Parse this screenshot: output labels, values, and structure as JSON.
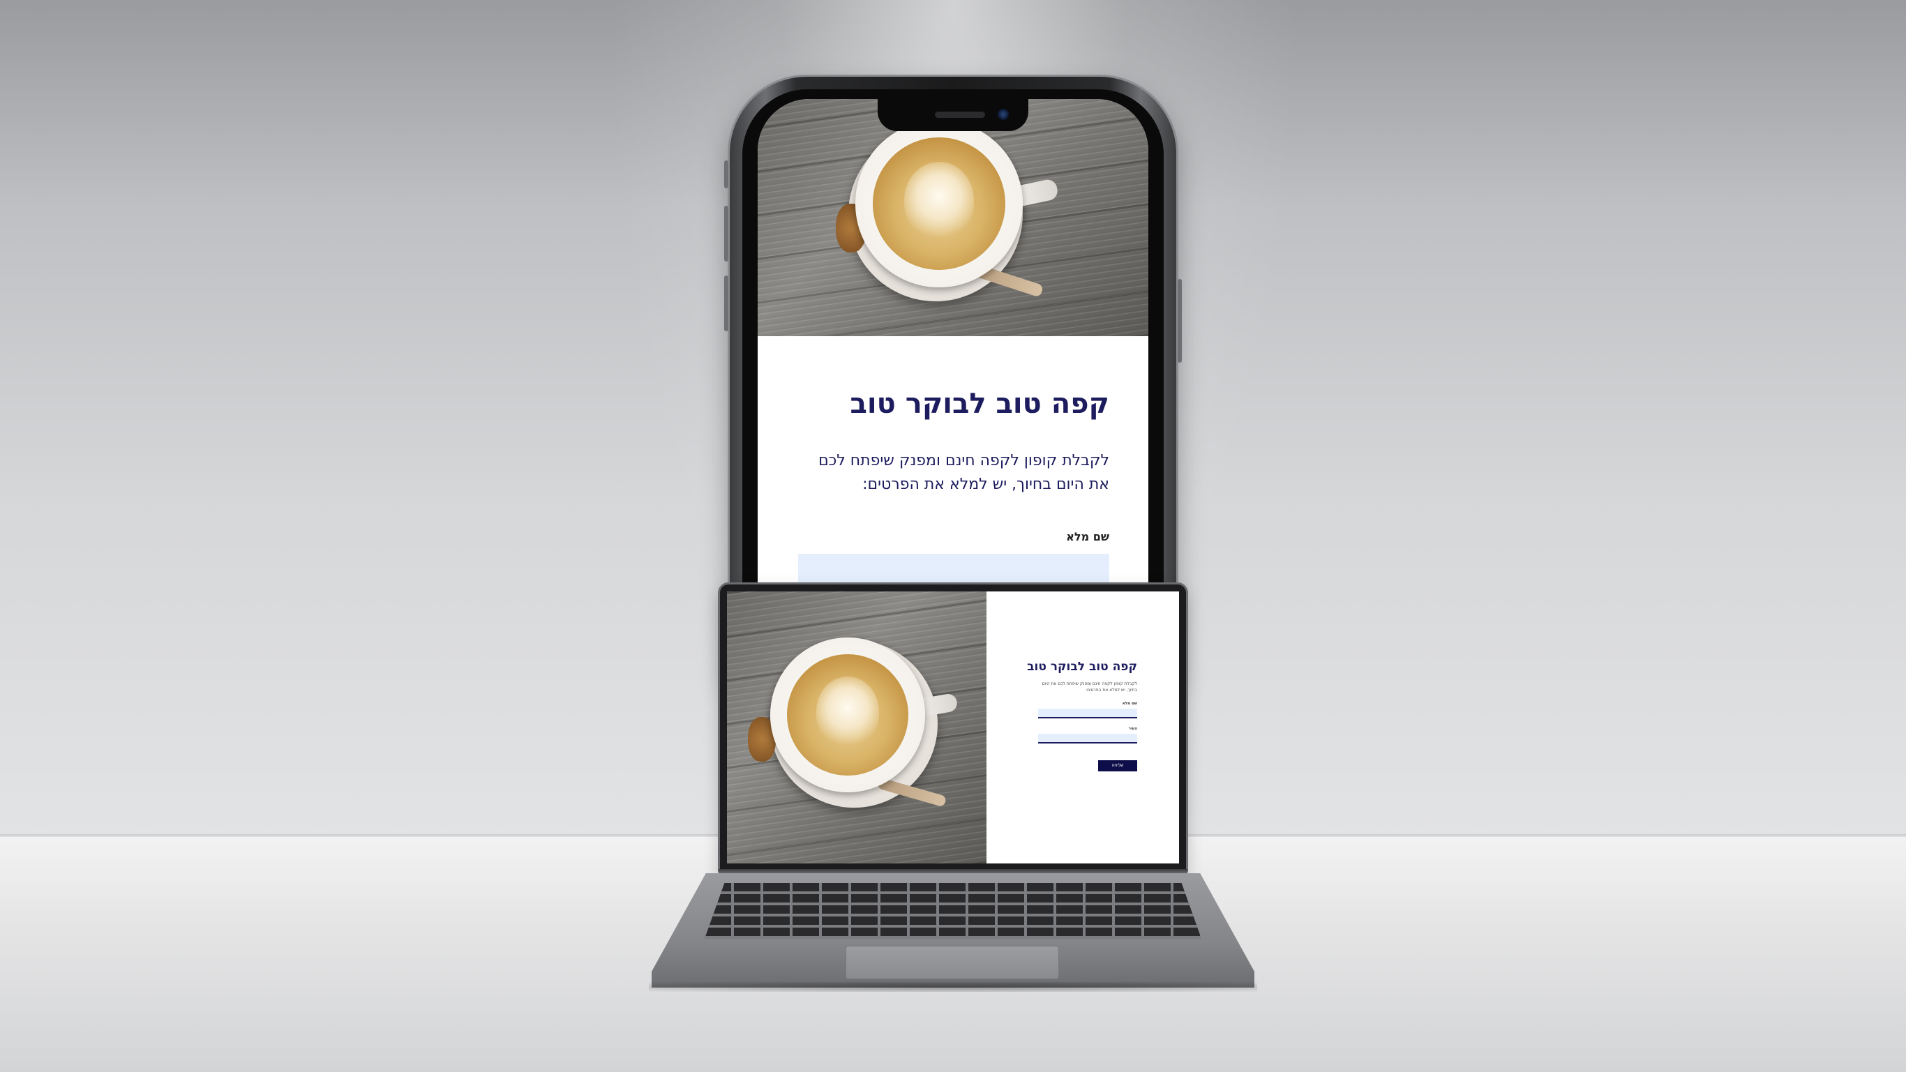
{
  "phone_page": {
    "title": "קפה טוב לבוקר טוב",
    "subtitle": "לקבלת קופון לקפה חינם ומפנק שיפתח לכם את היום בחיוך, יש למלא את הפרטים:",
    "field_label": "שם מלא"
  },
  "laptop_page": {
    "title": "קפה טוב לבוקר טוב",
    "subtitle": "לקבלת קופון לקפה חינם ומפנק שיפתח לכם את היום בחיוך, יש למלא את הפרטים:",
    "name_label": "שם מלא",
    "second_label": "העיר",
    "submit_label": "שליחה"
  },
  "icons": {
    "hero": "coffee-cup-latte-image"
  },
  "colors": {
    "heading": "#1c1c5e",
    "input_bg": "#e4eefd",
    "button_bg": "#0d0d4a"
  }
}
